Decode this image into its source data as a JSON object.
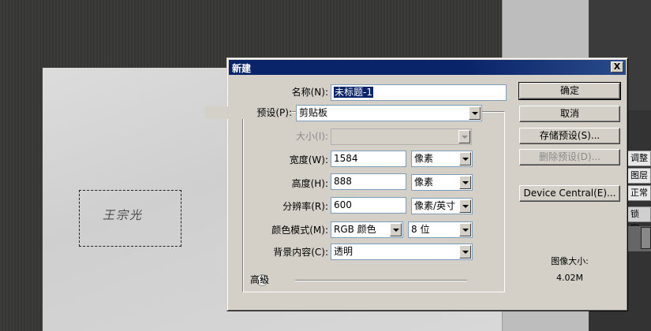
{
  "canvas": {
    "signature_text": "王宗光"
  },
  "right_panel": {
    "tab1": "调整",
    "tab2": "图层",
    "tab3": "正常",
    "tab4": "锁定:"
  },
  "dialog": {
    "title": "新建",
    "close_label": "X",
    "name_label": "名称(N):",
    "name_value": "未标题-1",
    "preset_label": "预设(P):",
    "preset_value": "剪贴板",
    "size_label": "大小(I):",
    "size_value": "",
    "width_label": "宽度(W):",
    "width_value": "1584",
    "width_unit": "像素",
    "height_label": "高度(H):",
    "height_value": "888",
    "height_unit": "像素",
    "resolution_label": "分辨率(R):",
    "resolution_value": "600",
    "resolution_unit": "像素/英寸",
    "color_mode_label": "颜色模式(M):",
    "color_mode_value": "RGB 颜色",
    "bit_depth_value": "8 位",
    "background_label": "背景内容(C):",
    "background_value": "透明",
    "advanced_label": "高级",
    "advanced_icon": "chevron-double-down-icon",
    "buttons": {
      "ok": "确定",
      "cancel": "取消",
      "save_preset": "存储预设(S)...",
      "delete_preset": "删除预设(D)...",
      "device_central": "Device Central(E)..."
    },
    "image_size_label": "图像大小:",
    "image_size_value": "4.02M"
  }
}
